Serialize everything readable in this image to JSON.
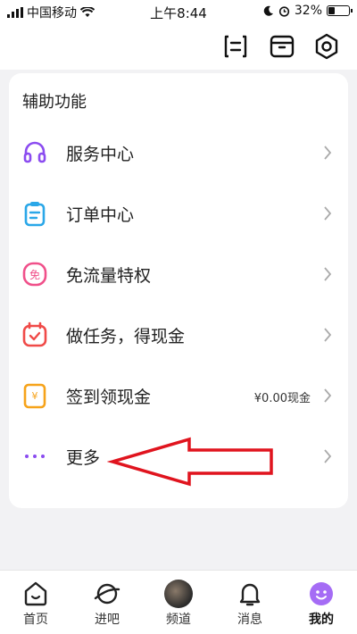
{
  "status_bar": {
    "carrier": "中国移动",
    "time": "上午8:44",
    "battery_percent_text": "32%",
    "battery_level": 0.32
  },
  "top_bar": {
    "icons": [
      "scan-icon",
      "box-icon",
      "settings-icon"
    ]
  },
  "section": {
    "title": "辅助功能",
    "items": [
      {
        "label": "服务中心",
        "icon": "headphones-icon",
        "color": "#8b4cf0",
        "extra": ""
      },
      {
        "label": "订单中心",
        "icon": "clipboard-icon",
        "color": "#2aa7e8",
        "extra": ""
      },
      {
        "label": "免流量特权",
        "icon": "free-data-icon",
        "color": "#f0508a",
        "extra": ""
      },
      {
        "label": "做任务，得现金",
        "icon": "calendar-check-icon",
        "color": "#f04a48",
        "extra": ""
      },
      {
        "label": "签到领现金",
        "icon": "yen-coupon-icon",
        "color": "#f6a31a",
        "extra": "¥0.00现金"
      },
      {
        "label": "更多",
        "icon": "more-dots-icon",
        "color": "#8b4cf0",
        "extra": ""
      }
    ]
  },
  "tabs": [
    {
      "label": "首页",
      "icon": "home-icon",
      "active": false
    },
    {
      "label": "进吧",
      "icon": "planet-icon",
      "active": false
    },
    {
      "label": "频道",
      "icon": "channel-thumbnail",
      "active": false
    },
    {
      "label": "消息",
      "icon": "bell-icon",
      "active": false
    },
    {
      "label": "我的",
      "icon": "profile-face-icon",
      "active": true
    }
  ],
  "colors": {
    "accent_purple": "#8b4cf0",
    "annotation_arrow": "#e0141e"
  }
}
